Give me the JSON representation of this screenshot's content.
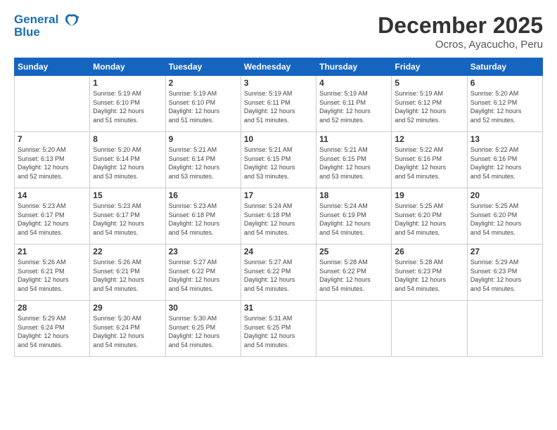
{
  "header": {
    "logo_line1": "General",
    "logo_line2": "Blue",
    "month": "December 2025",
    "location": "Ocros, Ayacucho, Peru"
  },
  "days_of_week": [
    "Sunday",
    "Monday",
    "Tuesday",
    "Wednesday",
    "Thursday",
    "Friday",
    "Saturday"
  ],
  "weeks": [
    [
      {
        "day": "",
        "info": ""
      },
      {
        "day": "1",
        "info": "Sunrise: 5:19 AM\nSunset: 6:10 PM\nDaylight: 12 hours\nand 51 minutes."
      },
      {
        "day": "2",
        "info": "Sunrise: 5:19 AM\nSunset: 6:10 PM\nDaylight: 12 hours\nand 51 minutes."
      },
      {
        "day": "3",
        "info": "Sunrise: 5:19 AM\nSunset: 6:11 PM\nDaylight: 12 hours\nand 51 minutes."
      },
      {
        "day": "4",
        "info": "Sunrise: 5:19 AM\nSunset: 6:11 PM\nDaylight: 12 hours\nand 52 minutes."
      },
      {
        "day": "5",
        "info": "Sunrise: 5:19 AM\nSunset: 6:12 PM\nDaylight: 12 hours\nand 52 minutes."
      },
      {
        "day": "6",
        "info": "Sunrise: 5:20 AM\nSunset: 6:12 PM\nDaylight: 12 hours\nand 52 minutes."
      }
    ],
    [
      {
        "day": "7",
        "info": "Sunrise: 5:20 AM\nSunset: 6:13 PM\nDaylight: 12 hours\nand 52 minutes."
      },
      {
        "day": "8",
        "info": "Sunrise: 5:20 AM\nSunset: 6:14 PM\nDaylight: 12 hours\nand 53 minutes."
      },
      {
        "day": "9",
        "info": "Sunrise: 5:21 AM\nSunset: 6:14 PM\nDaylight: 12 hours\nand 53 minutes."
      },
      {
        "day": "10",
        "info": "Sunrise: 5:21 AM\nSunset: 6:15 PM\nDaylight: 12 hours\nand 53 minutes."
      },
      {
        "day": "11",
        "info": "Sunrise: 5:21 AM\nSunset: 6:15 PM\nDaylight: 12 hours\nand 53 minutes."
      },
      {
        "day": "12",
        "info": "Sunrise: 5:22 AM\nSunset: 6:16 PM\nDaylight: 12 hours\nand 54 minutes."
      },
      {
        "day": "13",
        "info": "Sunrise: 5:22 AM\nSunset: 6:16 PM\nDaylight: 12 hours\nand 54 minutes."
      }
    ],
    [
      {
        "day": "14",
        "info": "Sunrise: 5:23 AM\nSunset: 6:17 PM\nDaylight: 12 hours\nand 54 minutes."
      },
      {
        "day": "15",
        "info": "Sunrise: 5:23 AM\nSunset: 6:17 PM\nDaylight: 12 hours\nand 54 minutes."
      },
      {
        "day": "16",
        "info": "Sunrise: 5:23 AM\nSunset: 6:18 PM\nDaylight: 12 hours\nand 54 minutes."
      },
      {
        "day": "17",
        "info": "Sunrise: 5:24 AM\nSunset: 6:18 PM\nDaylight: 12 hours\nand 54 minutes."
      },
      {
        "day": "18",
        "info": "Sunrise: 5:24 AM\nSunset: 6:19 PM\nDaylight: 12 hours\nand 54 minutes."
      },
      {
        "day": "19",
        "info": "Sunrise: 5:25 AM\nSunset: 6:20 PM\nDaylight: 12 hours\nand 54 minutes."
      },
      {
        "day": "20",
        "info": "Sunrise: 5:25 AM\nSunset: 6:20 PM\nDaylight: 12 hours\nand 54 minutes."
      }
    ],
    [
      {
        "day": "21",
        "info": "Sunrise: 5:26 AM\nSunset: 6:21 PM\nDaylight: 12 hours\nand 54 minutes."
      },
      {
        "day": "22",
        "info": "Sunrise: 5:26 AM\nSunset: 6:21 PM\nDaylight: 12 hours\nand 54 minutes."
      },
      {
        "day": "23",
        "info": "Sunrise: 5:27 AM\nSunset: 6:22 PM\nDaylight: 12 hours\nand 54 minutes."
      },
      {
        "day": "24",
        "info": "Sunrise: 5:27 AM\nSunset: 6:22 PM\nDaylight: 12 hours\nand 54 minutes."
      },
      {
        "day": "25",
        "info": "Sunrise: 5:28 AM\nSunset: 6:22 PM\nDaylight: 12 hours\nand 54 minutes."
      },
      {
        "day": "26",
        "info": "Sunrise: 5:28 AM\nSunset: 6:23 PM\nDaylight: 12 hours\nand 54 minutes."
      },
      {
        "day": "27",
        "info": "Sunrise: 5:29 AM\nSunset: 6:23 PM\nDaylight: 12 hours\nand 54 minutes."
      }
    ],
    [
      {
        "day": "28",
        "info": "Sunrise: 5:29 AM\nSunset: 6:24 PM\nDaylight: 12 hours\nand 54 minutes."
      },
      {
        "day": "29",
        "info": "Sunrise: 5:30 AM\nSunset: 6:24 PM\nDaylight: 12 hours\nand 54 minutes."
      },
      {
        "day": "30",
        "info": "Sunrise: 5:30 AM\nSunset: 6:25 PM\nDaylight: 12 hours\nand 54 minutes."
      },
      {
        "day": "31",
        "info": "Sunrise: 5:31 AM\nSunset: 6:25 PM\nDaylight: 12 hours\nand 54 minutes."
      },
      {
        "day": "",
        "info": ""
      },
      {
        "day": "",
        "info": ""
      },
      {
        "day": "",
        "info": ""
      }
    ]
  ]
}
